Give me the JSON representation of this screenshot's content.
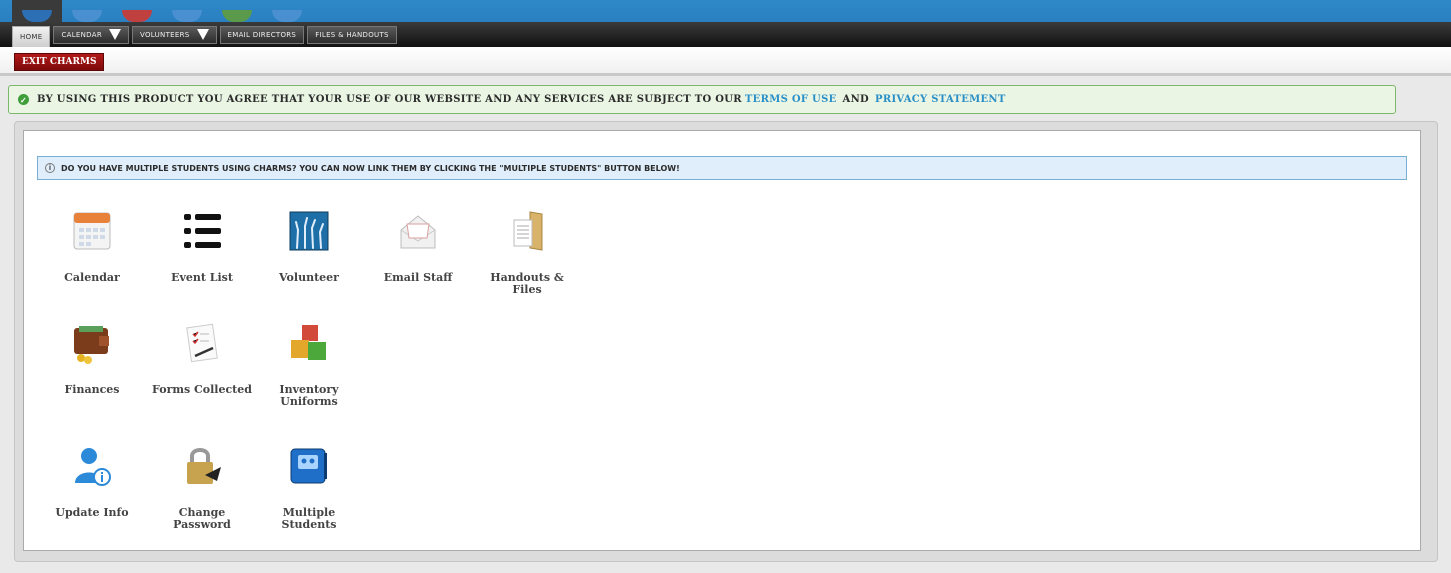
{
  "nav": {
    "tabs": [
      {
        "label": "HOME"
      },
      {
        "label": "CALENDAR"
      },
      {
        "label": "VOLUNTEERS"
      },
      {
        "label": "EMAIL DIRECTORS"
      },
      {
        "label": "FILES & HANDOUTS"
      }
    ]
  },
  "exit_label": "EXIT CHARMS",
  "notice": {
    "text": "BY USING THIS PRODUCT YOU AGREE THAT YOUR USE OF OUR WEBSITE AND ANY SERVICES ARE SUBJECT TO OUR",
    "terms": "TERMS OF USE",
    "and": "AND",
    "privacy": "PRIVACY STATEMENT"
  },
  "info": "DO YOU HAVE MULTIPLE STUDENTS USING CHARMS? YOU CAN NOW LINK THEM BY CLICKING THE \"MULTIPLE STUDENTS\" BUTTON BELOW!",
  "tiles": [
    {
      "label": "Calendar",
      "icon": "calendar-icon"
    },
    {
      "label": "Event List",
      "icon": "list-icon"
    },
    {
      "label": "Volunteer",
      "icon": "volunteer-hands-icon"
    },
    {
      "label": "Email Staff",
      "icon": "envelope-icon"
    },
    {
      "label": "Handouts & Files",
      "icon": "folder-icon"
    },
    {
      "label": "Finances",
      "icon": "wallet-icon"
    },
    {
      "label": "Forms Collected",
      "icon": "forms-icon"
    },
    {
      "label": "Inventory Uniforms",
      "icon": "boxes-icon"
    },
    {
      "label": "Update Info",
      "icon": "user-info-icon"
    },
    {
      "label": "Change Password",
      "icon": "padlock-icon"
    },
    {
      "label": "Multiple Students",
      "icon": "students-book-icon"
    }
  ]
}
